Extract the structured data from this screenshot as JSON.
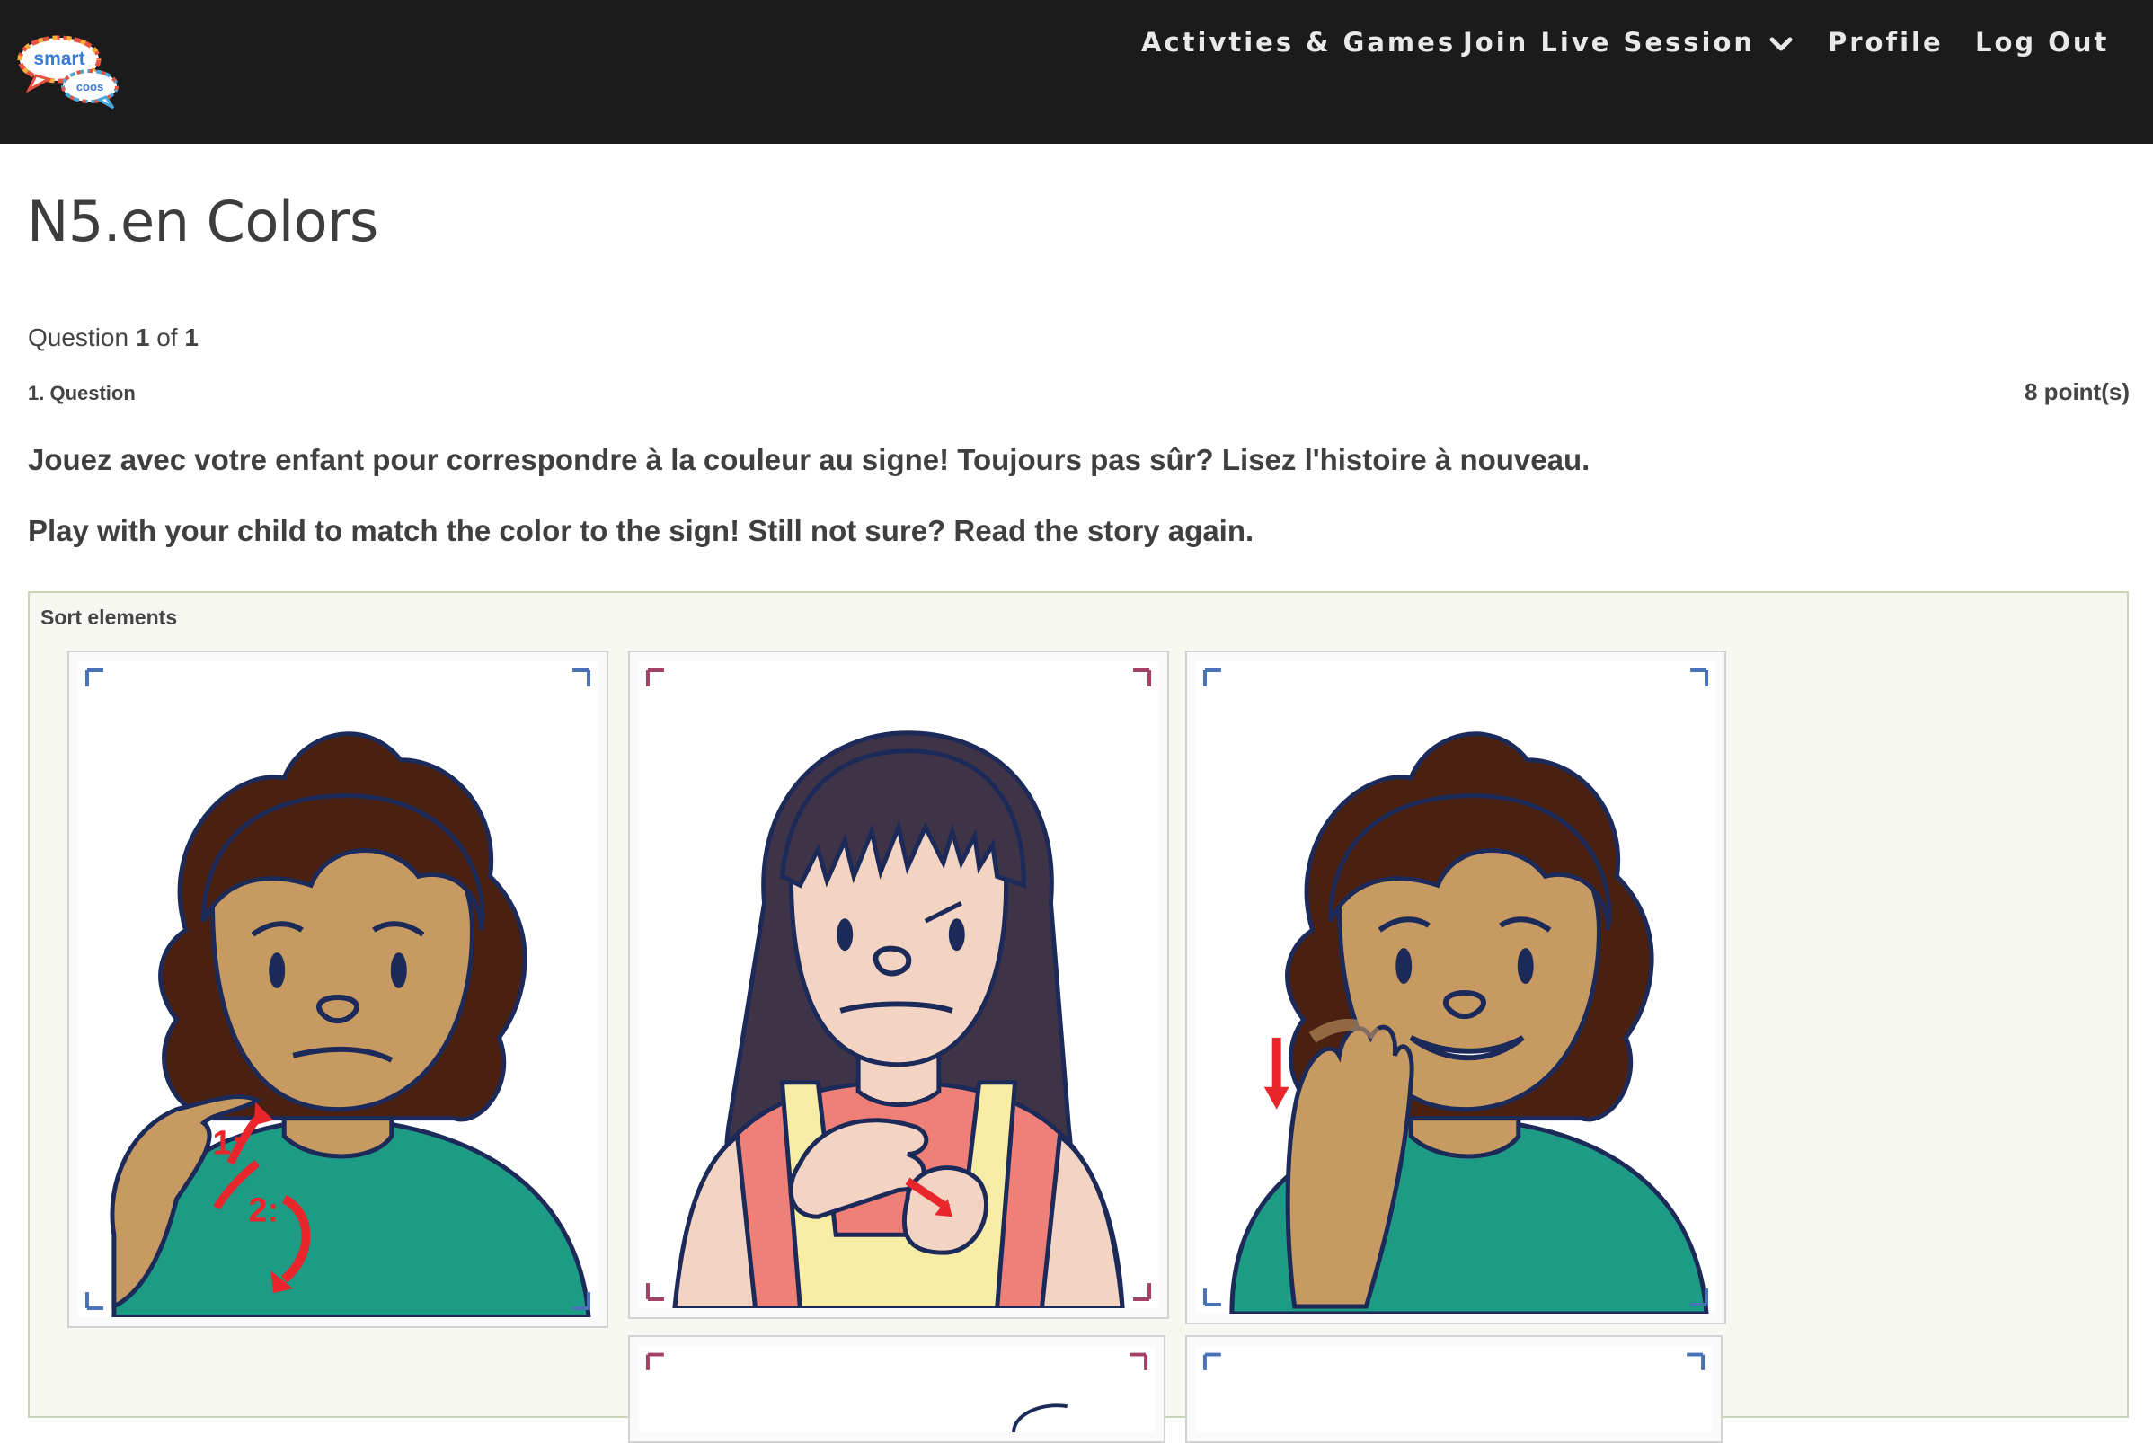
{
  "nav": {
    "logo_text_top": "smart",
    "logo_text_bottom": "coos",
    "activities": "Activties & Games",
    "live_session": "Join Live Session",
    "profile": "Profile",
    "logout": "Log Out"
  },
  "page": {
    "title": "N5.en Colors"
  },
  "quiz": {
    "counter_prefix": "Question",
    "counter_current": "1",
    "counter_of": "of",
    "counter_total": "1",
    "question_label": "1. Question",
    "points": "8 point(s)",
    "text_fr": "Jouez avec votre enfant pour correspondre à la couleur au signe! Toujours pas sûr? Lisez l'histoire à nouveau.",
    "text_en": "Play with your child to match the color to the sign! Still not sure? Read the story again."
  },
  "sort": {
    "title": "Sort elements",
    "cards": [
      {
        "icon": "boy-signing-color-1-image",
        "arrow_labels": [
          "1:",
          "2:"
        ]
      },
      {
        "icon": "girl-signing-color-image"
      },
      {
        "icon": "boy-signing-color-2-image"
      },
      {
        "icon": "sign-card-image-partial"
      },
      {
        "icon": "sign-card-image-partial"
      }
    ]
  },
  "colors": {
    "nav_bg": "#1b1b1b",
    "sort_border": "#c7d6b4",
    "sort_bg": "#f6f8f1",
    "skin_boy": "#c79a62",
    "skin_girl": "#f3d4c2",
    "hair_boy": "#4a2011",
    "hair_girl": "#3f3347",
    "shirt_green": "#1e9b84",
    "shirt_pink": "#ef8078",
    "overall_yellow": "#f8eda4",
    "arrow_red": "#e8262c"
  }
}
